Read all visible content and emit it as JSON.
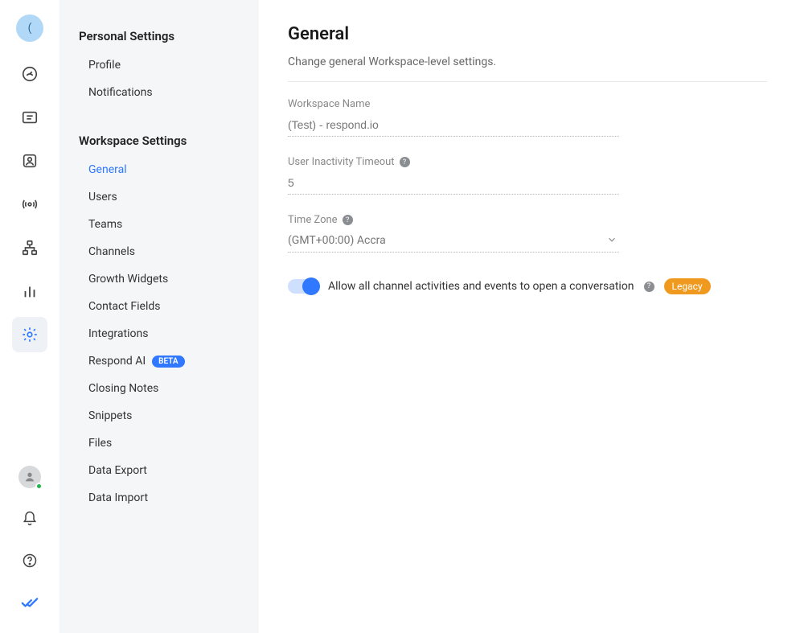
{
  "rail": {
    "avatar_letter": "("
  },
  "sidebar": {
    "sections": [
      {
        "title": "Personal Settings",
        "items": [
          {
            "label": "Profile"
          },
          {
            "label": "Notifications"
          }
        ]
      },
      {
        "title": "Workspace Settings",
        "items": [
          {
            "label": "General"
          },
          {
            "label": "Users"
          },
          {
            "label": "Teams"
          },
          {
            "label": "Channels"
          },
          {
            "label": "Growth Widgets"
          },
          {
            "label": "Contact Fields"
          },
          {
            "label": "Integrations"
          },
          {
            "label": "Respond AI",
            "badge": "BETA"
          },
          {
            "label": "Closing Notes"
          },
          {
            "label": "Snippets"
          },
          {
            "label": "Files"
          },
          {
            "label": "Data Export"
          },
          {
            "label": "Data Import"
          }
        ]
      }
    ]
  },
  "main": {
    "title": "General",
    "subtitle": "Change general Workspace-level settings.",
    "fields": {
      "workspace_name": {
        "label": "Workspace Name",
        "value": "(Test) - respond.io"
      },
      "inactivity": {
        "label": "User Inactivity Timeout",
        "value": "5"
      },
      "timezone": {
        "label": "Time Zone",
        "value": "(GMT+00:00) Accra"
      }
    },
    "toggle": {
      "label": "Allow all channel activities and events to open a conversation",
      "badge": "Legacy",
      "on": true
    }
  }
}
